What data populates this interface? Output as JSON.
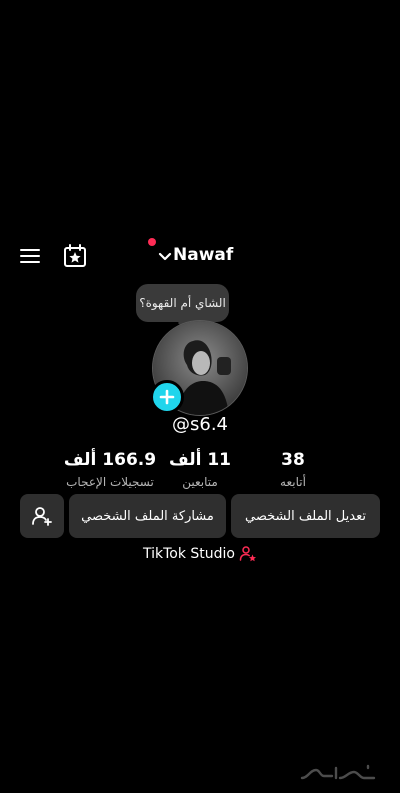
{
  "header": {
    "username": "Nawaf"
  },
  "note": {
    "text": "الشاي أم القهوة؟"
  },
  "profile": {
    "handle": "@s6.4"
  },
  "stats": [
    {
      "value": "166.9 ألف",
      "label": "تسجيلات الإعجاب"
    },
    {
      "value": "11 ألف",
      "label": "متابعين"
    },
    {
      "value": "38",
      "label": "أتابعه"
    }
  ],
  "buttons": {
    "edit_profile": "تعديل الملف الشخصي",
    "share_profile": "مشاركة الملف الشخصي"
  },
  "studio": {
    "label": "TikTok Studio"
  },
  "watermark": {
    "text": "حراج"
  },
  "colors": {
    "background": "#000000",
    "button_bg": "#2f2f2f",
    "notification_dot": "#fe2c55",
    "avatar_add": "#20d5ec"
  },
  "icons": {
    "menu": "menu-icon",
    "calendar": "calendar-star-icon",
    "chevron": "chevron-down-icon",
    "add_friend": "add-user-icon",
    "studio": "creator-icon",
    "plus": "plus-icon"
  }
}
